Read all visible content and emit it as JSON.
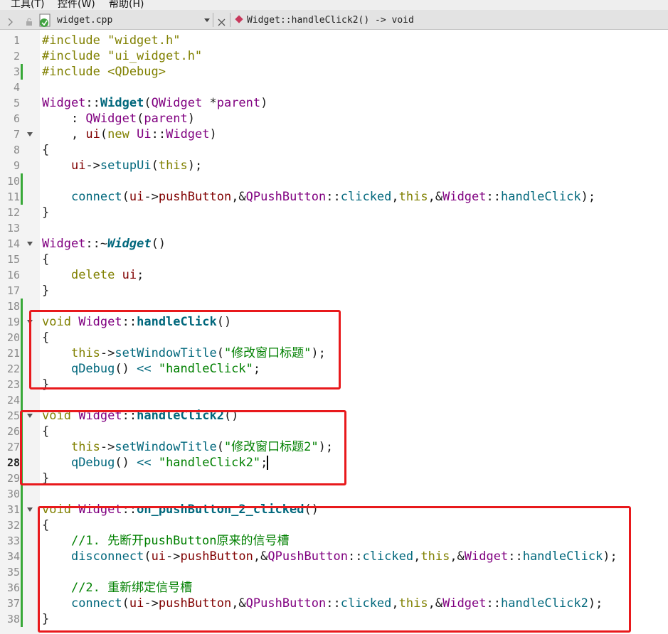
{
  "menu": [
    {
      "label": "工具(T)"
    },
    {
      "label": "控件(W)"
    },
    {
      "label": "帮助(H)"
    }
  ],
  "toolbar": {
    "file_name": "widget.cpp",
    "function_signature": "Widget::handleClick2() -> void"
  },
  "editor": {
    "current_line": 28,
    "line_numbers": [
      "1",
      "2",
      "3",
      "4",
      "5",
      "6",
      "7",
      "8",
      "9",
      "10",
      "11",
      "12",
      "13",
      "14",
      "15",
      "16",
      "17",
      "18",
      "19",
      "20",
      "21",
      "22",
      "23",
      "24",
      "25",
      "26",
      "27",
      "28",
      "29",
      "30",
      "31",
      "32",
      "33",
      "34",
      "35",
      "36",
      "37",
      "38"
    ],
    "lines": [
      [
        {
          "t": "#include \"widget.h\"",
          "c": "k"
        }
      ],
      [
        {
          "t": "#include \"ui_widget.h\"",
          "c": "k"
        }
      ],
      [
        {
          "t": "#include <QDebug>",
          "c": "k"
        }
      ],
      [],
      [
        {
          "t": "Widget",
          "c": "t"
        },
        {
          "t": "::",
          "c": "p"
        },
        {
          "t": "Widget",
          "c": "fb"
        },
        {
          "t": "(",
          "c": "p"
        },
        {
          "t": "QWidget",
          "c": "t"
        },
        {
          "t": " *",
          "c": "p"
        },
        {
          "t": "parent",
          "c": "t"
        },
        {
          "t": ")",
          "c": "p"
        }
      ],
      [
        {
          "t": "    : ",
          "c": "p"
        },
        {
          "t": "QWidget",
          "c": "t"
        },
        {
          "t": "(",
          "c": "p"
        },
        {
          "t": "parent",
          "c": "t"
        },
        {
          "t": ")",
          "c": "p"
        }
      ],
      [
        {
          "t": "    , ",
          "c": "p"
        },
        {
          "t": "ui",
          "c": "m"
        },
        {
          "t": "(",
          "c": "p"
        },
        {
          "t": "new",
          "c": "k"
        },
        {
          "t": " ",
          "c": "p"
        },
        {
          "t": "Ui",
          "c": "t"
        },
        {
          "t": "::",
          "c": "p"
        },
        {
          "t": "Widget",
          "c": "t"
        },
        {
          "t": ")",
          "c": "p"
        }
      ],
      [
        {
          "t": "{",
          "c": "p"
        }
      ],
      [
        {
          "t": "    ",
          "c": "p"
        },
        {
          "t": "ui",
          "c": "m"
        },
        {
          "t": "->",
          "c": "p"
        },
        {
          "t": "setupUi",
          "c": "f"
        },
        {
          "t": "(",
          "c": "p"
        },
        {
          "t": "this",
          "c": "k"
        },
        {
          "t": ");",
          "c": "p"
        }
      ],
      [],
      [
        {
          "t": "    ",
          "c": "p"
        },
        {
          "t": "connect",
          "c": "f"
        },
        {
          "t": "(",
          "c": "p"
        },
        {
          "t": "ui",
          "c": "m"
        },
        {
          "t": "->",
          "c": "p"
        },
        {
          "t": "pushButton",
          "c": "m"
        },
        {
          "t": ",&",
          "c": "p"
        },
        {
          "t": "QPushButton",
          "c": "t"
        },
        {
          "t": "::",
          "c": "p"
        },
        {
          "t": "clicked",
          "c": "f"
        },
        {
          "t": ",",
          "c": "p"
        },
        {
          "t": "this",
          "c": "k"
        },
        {
          "t": ",&",
          "c": "p"
        },
        {
          "t": "Widget",
          "c": "t"
        },
        {
          "t": "::",
          "c": "p"
        },
        {
          "t": "handleClick",
          "c": "f"
        },
        {
          "t": ");",
          "c": "p"
        }
      ],
      [
        {
          "t": "}",
          "c": "p"
        }
      ],
      [],
      [
        {
          "t": "Widget",
          "c": "t"
        },
        {
          "t": "::~",
          "c": "p"
        },
        {
          "t": "Widget",
          "c": "fi"
        },
        {
          "t": "()",
          "c": "p"
        }
      ],
      [
        {
          "t": "{",
          "c": "p"
        }
      ],
      [
        {
          "t": "    ",
          "c": "p"
        },
        {
          "t": "delete",
          "c": "k"
        },
        {
          "t": " ",
          "c": "p"
        },
        {
          "t": "ui",
          "c": "m"
        },
        {
          "t": ";",
          "c": "p"
        }
      ],
      [
        {
          "t": "}",
          "c": "p"
        }
      ],
      [],
      [
        {
          "t": "void",
          "c": "k"
        },
        {
          "t": " ",
          "c": "p"
        },
        {
          "t": "Widget",
          "c": "t"
        },
        {
          "t": "::",
          "c": "p"
        },
        {
          "t": "handleClick",
          "c": "fb"
        },
        {
          "t": "()",
          "c": "p"
        }
      ],
      [
        {
          "t": "{",
          "c": "p"
        }
      ],
      [
        {
          "t": "    ",
          "c": "p"
        },
        {
          "t": "this",
          "c": "k"
        },
        {
          "t": "->",
          "c": "p"
        },
        {
          "t": "setWindowTitle",
          "c": "f"
        },
        {
          "t": "(",
          "c": "p"
        },
        {
          "t": "\"修改窗口标题\"",
          "c": "s"
        },
        {
          "t": ");",
          "c": "p"
        }
      ],
      [
        {
          "t": "    ",
          "c": "p"
        },
        {
          "t": "qDebug",
          "c": "f"
        },
        {
          "t": "() ",
          "c": "p"
        },
        {
          "t": "<<",
          "c": "f"
        },
        {
          "t": " ",
          "c": "p"
        },
        {
          "t": "\"handleClick\"",
          "c": "s"
        },
        {
          "t": ";",
          "c": "p"
        }
      ],
      [
        {
          "t": "}",
          "c": "p"
        }
      ],
      [],
      [
        {
          "t": "void",
          "c": "k"
        },
        {
          "t": " ",
          "c": "p"
        },
        {
          "t": "Widget",
          "c": "t"
        },
        {
          "t": "::",
          "c": "p"
        },
        {
          "t": "handleClick2",
          "c": "fb"
        },
        {
          "t": "()",
          "c": "p"
        }
      ],
      [
        {
          "t": "{",
          "c": "p"
        }
      ],
      [
        {
          "t": "    ",
          "c": "p"
        },
        {
          "t": "this",
          "c": "k"
        },
        {
          "t": "->",
          "c": "p"
        },
        {
          "t": "setWindowTitle",
          "c": "f"
        },
        {
          "t": "(",
          "c": "p"
        },
        {
          "t": "\"修改窗口标题2\"",
          "c": "s"
        },
        {
          "t": ");",
          "c": "p"
        }
      ],
      [
        {
          "t": "    ",
          "c": "p"
        },
        {
          "t": "qDebug",
          "c": "f"
        },
        {
          "t": "() ",
          "c": "p"
        },
        {
          "t": "<<",
          "c": "f"
        },
        {
          "t": " ",
          "c": "p"
        },
        {
          "t": "\"handleClick2\"",
          "c": "s"
        },
        {
          "t": ";",
          "c": "p"
        }
      ],
      [
        {
          "t": "}",
          "c": "p"
        }
      ],
      [],
      [
        {
          "t": "void",
          "c": "k"
        },
        {
          "t": " ",
          "c": "p"
        },
        {
          "t": "Widget",
          "c": "t"
        },
        {
          "t": "::",
          "c": "p"
        },
        {
          "t": "on_pushButton_2_clicked",
          "c": "fb"
        },
        {
          "t": "()",
          "c": "p"
        }
      ],
      [
        {
          "t": "{",
          "c": "p"
        }
      ],
      [
        {
          "t": "    ",
          "c": "p"
        },
        {
          "t": "//1. 先断开pushButton原来的信号槽",
          "c": "c"
        }
      ],
      [
        {
          "t": "    ",
          "c": "p"
        },
        {
          "t": "disconnect",
          "c": "f"
        },
        {
          "t": "(",
          "c": "p"
        },
        {
          "t": "ui",
          "c": "m"
        },
        {
          "t": "->",
          "c": "p"
        },
        {
          "t": "pushButton",
          "c": "m"
        },
        {
          "t": ",&",
          "c": "p"
        },
        {
          "t": "QPushButton",
          "c": "t"
        },
        {
          "t": "::",
          "c": "p"
        },
        {
          "t": "clicked",
          "c": "f"
        },
        {
          "t": ",",
          "c": "p"
        },
        {
          "t": "this",
          "c": "k"
        },
        {
          "t": ",&",
          "c": "p"
        },
        {
          "t": "Widget",
          "c": "t"
        },
        {
          "t": "::",
          "c": "p"
        },
        {
          "t": "handleClick",
          "c": "f"
        },
        {
          "t": ");",
          "c": "p"
        }
      ],
      [],
      [
        {
          "t": "    ",
          "c": "p"
        },
        {
          "t": "//2. 重新绑定信号槽",
          "c": "c"
        }
      ],
      [
        {
          "t": "    ",
          "c": "p"
        },
        {
          "t": "connect",
          "c": "f"
        },
        {
          "t": "(",
          "c": "p"
        },
        {
          "t": "ui",
          "c": "m"
        },
        {
          "t": "->",
          "c": "p"
        },
        {
          "t": "pushButton",
          "c": "m"
        },
        {
          "t": ",&",
          "c": "p"
        },
        {
          "t": "QPushButton",
          "c": "t"
        },
        {
          "t": "::",
          "c": "p"
        },
        {
          "t": "clicked",
          "c": "f"
        },
        {
          "t": ",",
          "c": "p"
        },
        {
          "t": "this",
          "c": "k"
        },
        {
          "t": ",&",
          "c": "p"
        },
        {
          "t": "Widget",
          "c": "t"
        },
        {
          "t": "::",
          "c": "p"
        },
        {
          "t": "handleClick2",
          "c": "f"
        },
        {
          "t": ");",
          "c": "p"
        }
      ],
      [
        {
          "t": "}",
          "c": "p"
        }
      ]
    ]
  },
  "colors": {
    "highlight_box": "#e8191c",
    "keyword": "#808000",
    "type": "#800080",
    "function": "#00677c",
    "string": "#008000",
    "member": "#800000",
    "change_bar": "#38a838"
  }
}
